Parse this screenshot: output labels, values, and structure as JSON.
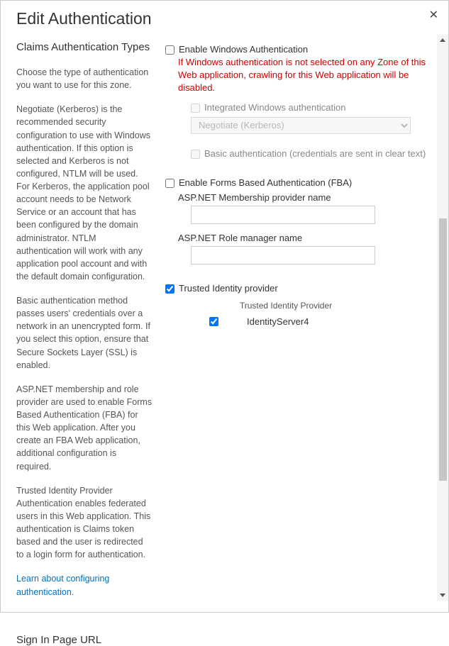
{
  "dialog": {
    "title": "Edit Authentication"
  },
  "left": {
    "section_title": "Claims Authentication Types",
    "p1": "Choose the type of authentication you want to use for this zone.",
    "p2": "Negotiate (Kerberos) is the recommended security configuration to use with Windows authentication. If this option is selected and Kerberos is not configured, NTLM will be used. For Kerberos, the application pool account needs to be Network Service or an account that has been configured by the domain administrator. NTLM authentication will work with any application pool account and with the default domain configuration.",
    "p3": "Basic authentication method passes users' credentials over a network in an unencrypted form. If you select this option, ensure that Secure Sockets Layer (SSL) is enabled.",
    "p4": "ASP.NET membership and role provider are used to enable Forms Based Authentication (FBA) for this Web application. After you create an FBA Web application, additional configuration is required.",
    "p5": "Trusted Identity Provider Authentication enables federated users in this Web application. This authentication is Claims token based and the user is redirected to a login form for authentication.",
    "link": "Learn about configuring authentication.",
    "signin_title": "Sign In Page URL"
  },
  "right": {
    "enable_windows": "Enable Windows Authentication",
    "windows_warning": "If Windows authentication is not selected on any Zone of this Web application, crawling for this Web application will be disabled.",
    "integrated_label": "Integrated Windows authentication",
    "negotiate_option": "Negotiate (Kerberos)",
    "basic_label": "Basic authentication (credentials are sent in clear text)",
    "enable_fba": "Enable Forms Based Authentication (FBA)",
    "membership_label": "ASP.NET Membership provider name",
    "role_label": "ASP.NET Role manager name",
    "trusted_label": "Trusted Identity provider",
    "trusted_header": "Trusted Identity Provider",
    "trusted_item": "IdentityServer4"
  }
}
